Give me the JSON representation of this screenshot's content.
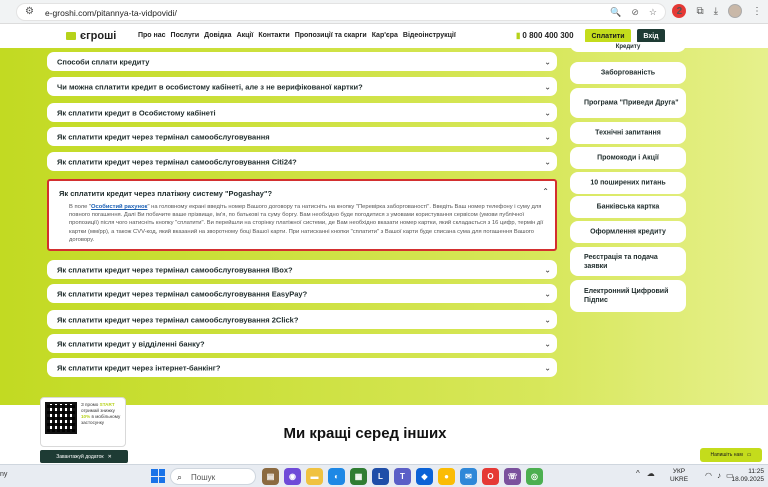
{
  "browser": {
    "url": "e-groshi.com/pitannya-ta-vidpovidi/",
    "extension_badge": "2"
  },
  "site": {
    "logo_text": "єгроші",
    "menu": [
      "Про нас",
      "Послуги",
      "Довідка",
      "Акції",
      "Контакти",
      "Пропозиції та скарги",
      "Кар'єра",
      "Відеоінструкції"
    ],
    "phone": "0 800 400 300",
    "pay_button": "Сплатити",
    "login_button": "Вхід"
  },
  "faq": [
    {
      "q": "Способи сплати кредиту"
    },
    {
      "q": "Чи можна сплатити кредит в особистому кабінеті, але з не верифікованої картки?"
    },
    {
      "q": "Як сплатити кредит в Особистому кабінеті"
    },
    {
      "q": "Як сплатити кредит через термінал самообслуговування"
    },
    {
      "q": "Як сплатити кредит через термінал самообслуговування Citi24?"
    },
    {
      "q": "Як сплатити кредит через платіжну систему \"Pogashay\"?"
    },
    {
      "q": "Як сплатити кредит через термінал самообслуговування IBox?"
    },
    {
      "q": "Як сплатити кредит через термінал самообслуговування EasyPay?"
    },
    {
      "q": "Як сплатити кредит через термінал самообслуговування 2Click?"
    },
    {
      "q": "Як сплатити кредит у відділенні банку?"
    },
    {
      "q": "Як сплатити кредит через інтернет-банкінг?"
    }
  ],
  "open_answer": {
    "prefix": "В поле \"",
    "link": "Особистий рахунок",
    "text": "\" на головному екрані введіть номер Вашого договору та натисніть на кнопку \"Перевірка заборгованості\". Введіть Ваш номер телефону і суму для повного погашення. Далі Ви побачите ваше прізвище, ім'я, по батькові та суму боргу. Вам необхідно буде погодитися з умовами користування сервісом (умови публічної пропозиції) після чого натисніть кнопку \"сплатити\". Ви перейшли на сторінку платіжної системи, де Вам необхідно вказати номер картки, який складається з 16 цифр, термін дії картки (мм/рр), а також CVV-код, який вказаний на зворотному боці Вашої карти. При натисканні кнопки \"сплатити\" з Вашої карти буде списана сума для погашення Вашого договору."
  },
  "sidebar": [
    "Кредиту",
    "Заборгованість",
    "Програма \"Приведи Друга\"",
    "Технічні запитання",
    "Промокоди і Акції",
    "10 поширених питань",
    "Банківська картка",
    "Оформлення кредиту",
    "Реєстрація та подача заявки",
    "Електронний Цифровий Підпис"
  ],
  "promo": {
    "line1": "З промо",
    "start": "START",
    "line2": "отримай знижку",
    "discount": "10%",
    "line3": "в мобільному застосунку",
    "download": "Завантажуй додаток"
  },
  "headline": "Ми кращі серед інших",
  "write_us": "Напишіть нам",
  "taskbar": {
    "left_text": "ny",
    "search_placeholder": "Пошук",
    "lang_top": "УКР",
    "lang_bottom": "UKRE",
    "time": "11:25",
    "date": "18.09.2025"
  }
}
